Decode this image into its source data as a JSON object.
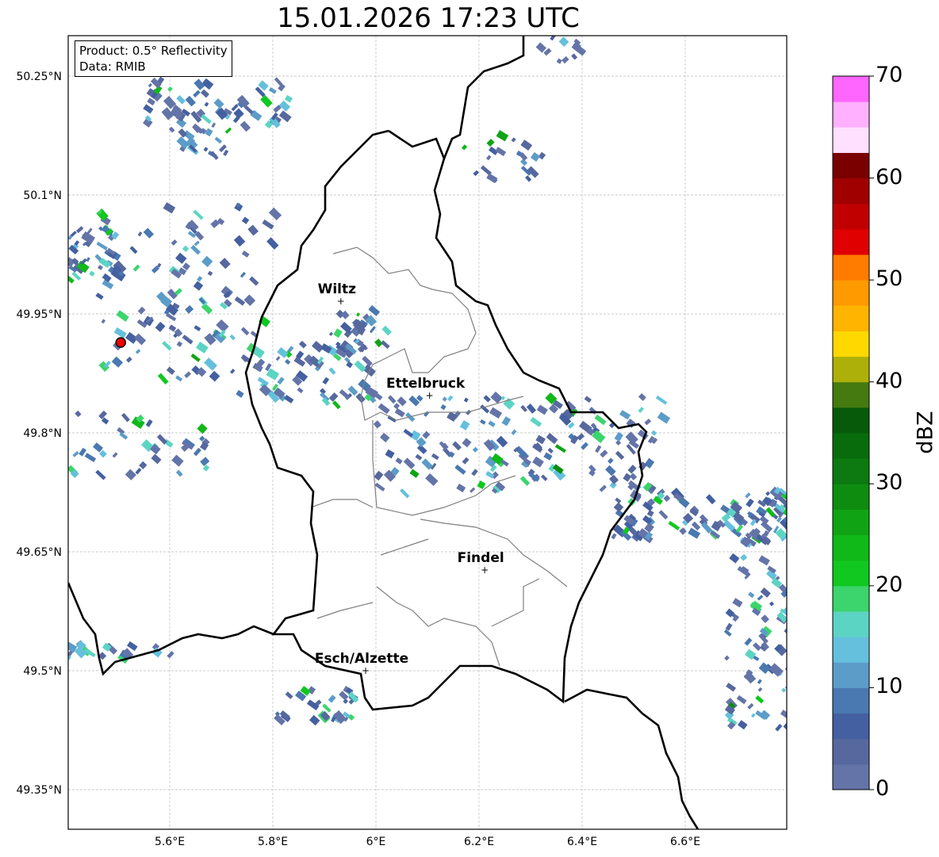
{
  "title": "15.01.2026 17:23 UTC",
  "info": {
    "product": "Product: 0.5° Reflectivity",
    "data": "Data: RMIB"
  },
  "map": {
    "lon_ticks": [
      {
        "v": 5.6,
        "label": "5.6°E"
      },
      {
        "v": 5.8,
        "label": "5.8°E"
      },
      {
        "v": 6.0,
        "label": "6°E"
      },
      {
        "v": 6.2,
        "label": "6.2°E"
      },
      {
        "v": 6.4,
        "label": "6.4°E"
      },
      {
        "v": 6.6,
        "label": "6.6°E"
      }
    ],
    "lat_ticks": [
      {
        "v": 50.25,
        "label": "50.25°N"
      },
      {
        "v": 50.1,
        "label": "50.1°N"
      },
      {
        "v": 49.95,
        "label": "49.95°N"
      },
      {
        "v": 49.8,
        "label": "49.8°N"
      },
      {
        "v": 49.65,
        "label": "49.65°N"
      },
      {
        "v": 49.5,
        "label": "49.5°N"
      },
      {
        "v": 49.35,
        "label": "49.35°N"
      }
    ],
    "cities": [
      {
        "name": "Wiltz",
        "lon": 5.932,
        "lat": 49.966
      },
      {
        "name": "Ettelbruck",
        "lon": 6.104,
        "lat": 49.847
      },
      {
        "name": "Findel",
        "lon": 6.211,
        "lat": 49.627
      },
      {
        "name": "Esch/Alzette",
        "lon": 5.98,
        "lat": 49.5
      }
    ],
    "radar_site": {
      "lon": 5.505,
      "lat": 49.914
    }
  },
  "colorbar": {
    "unit": "dBZ",
    "min": 0,
    "max": 70,
    "ticks": [
      "0",
      "10",
      "20",
      "30",
      "40",
      "50",
      "60",
      "70"
    ],
    "colors": [
      "#6474a8",
      "#56689e",
      "#4460a0",
      "#4a78b0",
      "#5c9cc8",
      "#64c0dc",
      "#5cd4c4",
      "#3cd46c",
      "#10c820",
      "#10b818",
      "#10a414",
      "#0e8c10",
      "#0c7a10",
      "#086c0c",
      "#065a0a",
      "#447a10",
      "#aeb00a",
      "#ffd800",
      "#ffb400",
      "#ff9a00",
      "#ff7c00",
      "#e00000",
      "#c00000",
      "#a00000",
      "#7a0000",
      "#ffe0ff",
      "#ffb0ff",
      "#ff66ff",
      "#e830f0"
    ]
  }
}
